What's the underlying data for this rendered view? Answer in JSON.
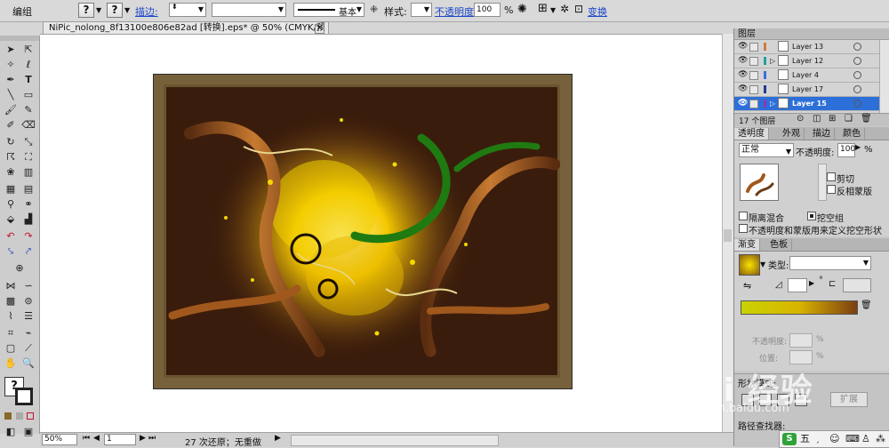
{
  "control_bar": {
    "mode": "编组",
    "stroke_label": "描边:",
    "stroke_profile": "基本",
    "style_label": "样式:",
    "opacity_label": "不透明度:",
    "opacity_value": "100",
    "opacity_unit": "%",
    "transform_label": "变换",
    "q1": "?",
    "q2": "?"
  },
  "document": {
    "tab_title": "NiPic_nolong_8f13100e806e82ad [转换].eps* @ 50% (CMYK/预览)",
    "close": "×"
  },
  "status_bar": {
    "zoom": "50%",
    "artboard": "1",
    "status_text": "27 次还原；无重做"
  },
  "layers_panel": {
    "title": "图层",
    "count": "17 个图层",
    "rows": [
      {
        "name": "Layer 13",
        "color": "#d27a3c",
        "selected": false
      },
      {
        "name": "Layer 12",
        "color": "#1ca3a0",
        "selected": false
      },
      {
        "name": "Layer 4",
        "color": "#3b6fe0",
        "selected": false
      },
      {
        "name": "Layer 17",
        "color": "#1c3a92",
        "selected": false
      },
      {
        "name": "Layer 15",
        "color": "#8a3ab8",
        "selected": true
      }
    ]
  },
  "transparency_panel": {
    "tabs": [
      "透明度",
      "外观",
      "描边",
      "颜色"
    ],
    "blend_mode": "正常",
    "opacity_label": "不透明度:",
    "opacity_value": "100",
    "opacity_unit": "%",
    "clip": "剪切",
    "invert_mask": "反相蒙版",
    "isolate_blending": "隔离混合",
    "knockout_group": "挖空组",
    "opacity_mask_text": "不透明度和蒙版用来定义挖空形状"
  },
  "gradient_panel": {
    "tabs": [
      "渐变",
      "色板"
    ],
    "type_label": "类型:",
    "angle_symbol": "°",
    "opacity_label": "不透明度:",
    "opacity_unit": "%",
    "location_label": "位置:",
    "location_unit": "%"
  },
  "bottom_panel": {
    "expand_label": "扩展",
    "pathfinder_label": "路径查找器:",
    "shape_mode_label": "形状模式:"
  },
  "watermark": {
    "brand": "Bai 经验",
    "url": "jingyan.baidu.com"
  },
  "ime": {
    "label": "五"
  },
  "colors": {
    "artboard_border": "#77613a",
    "art_bg": "#3a1c0c",
    "selected_layer": "#2d6fd8",
    "gradient_start": "#c8d400",
    "gradient_end": "#7a3e12"
  }
}
